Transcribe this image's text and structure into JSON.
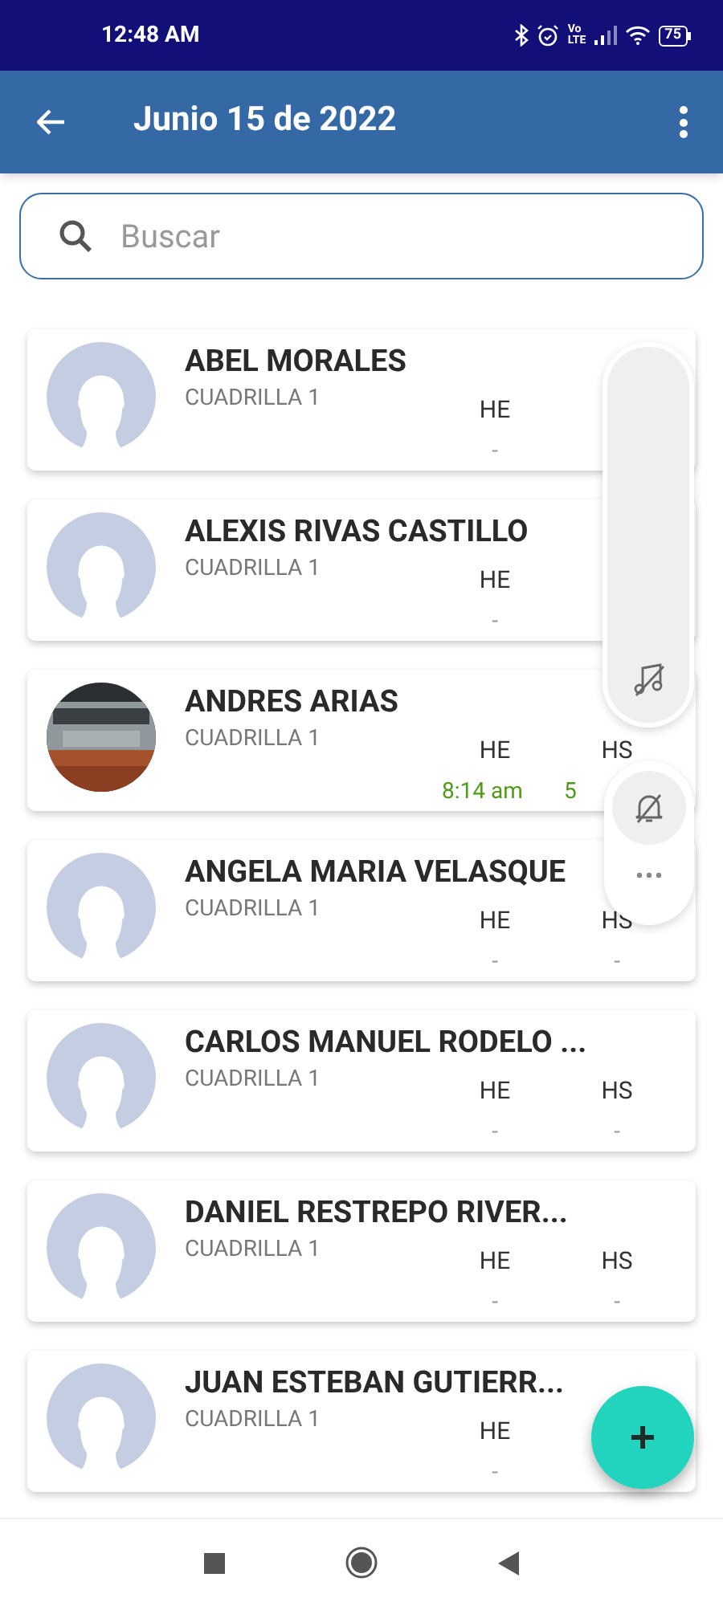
{
  "status_bar": {
    "time": "12:48 AM",
    "network": [
      "Vo",
      "LTE"
    ],
    "battery": "75"
  },
  "app_bar": {
    "title": "Junio 15 de 2022"
  },
  "search": {
    "placeholder": "Buscar"
  },
  "workers": [
    {
      "name": "ABEL MORALES",
      "crew": "CUADRILLA 1",
      "has_photo": false,
      "he_label": "HE",
      "he_value": "-",
      "he_recorded": false
    },
    {
      "name": "ALEXIS RIVAS CASTILLO",
      "crew": "CUADRILLA 1",
      "has_photo": false,
      "he_label": "HE",
      "he_value": "-",
      "he_recorded": false
    },
    {
      "name": "ANDRES ARIAS",
      "crew": "CUADRILLA 1",
      "has_photo": true,
      "he_label": "HE",
      "he_value": "8:14 am",
      "he_recorded": true,
      "hs_label": "HS",
      "hs_value": "5",
      "hs_recorded": true
    },
    {
      "name": "ANGELA MARIA VELASQUE",
      "crew": "CUADRILLA 1",
      "has_photo": false,
      "he_label": "HE",
      "he_value": "-",
      "he_recorded": false,
      "hs_label": "HS",
      "hs_value": "-",
      "hs_recorded": false
    },
    {
      "name": "CARLOS MANUEL RODELO ...",
      "crew": "CUADRILLA 1",
      "has_photo": false,
      "he_label": "HE",
      "he_value": "-",
      "he_recorded": false,
      "hs_label": "HS",
      "hs_value": "-",
      "hs_recorded": false
    },
    {
      "name": "DANIEL RESTREPO RIVER...",
      "crew": "CUADRILLA 1",
      "has_photo": false,
      "he_label": "HE",
      "he_value": "-",
      "he_recorded": false,
      "hs_label": "HS",
      "hs_value": "-",
      "hs_recorded": false
    },
    {
      "name": "JUAN ESTEBAN  GUTIERR...",
      "crew": "CUADRILLA 1",
      "has_photo": false,
      "he_label": "HE",
      "he_value": "-",
      "he_recorded": false
    }
  ]
}
